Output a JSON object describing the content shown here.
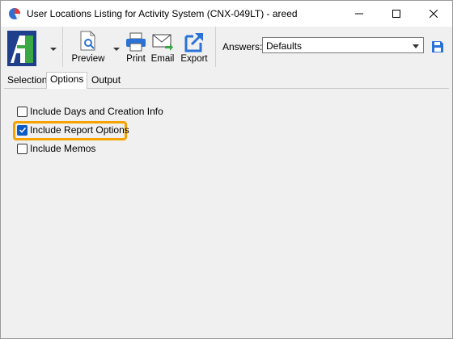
{
  "window": {
    "title": "User Locations Listing for Activity System (CNX-049LT) - areed"
  },
  "toolbar": {
    "preview_label": "Preview",
    "print_label": "Print",
    "email_label": "Email",
    "export_label": "Export",
    "answers_label": "Answers:",
    "answers_value": "Defaults"
  },
  "tabs": [
    {
      "label": "Selection"
    },
    {
      "label": "Options"
    },
    {
      "label": "Output"
    }
  ],
  "options": [
    {
      "label": "Include Days and Creation Info",
      "checked": false
    },
    {
      "label": "Include Report Options",
      "checked": true
    },
    {
      "label": "Include Memos",
      "checked": false
    }
  ],
  "colors": {
    "accent": "#0a5bc4",
    "highlight": "#f5a300",
    "logo_blue": "#1f3e8c",
    "logo_green": "#3aa845"
  }
}
